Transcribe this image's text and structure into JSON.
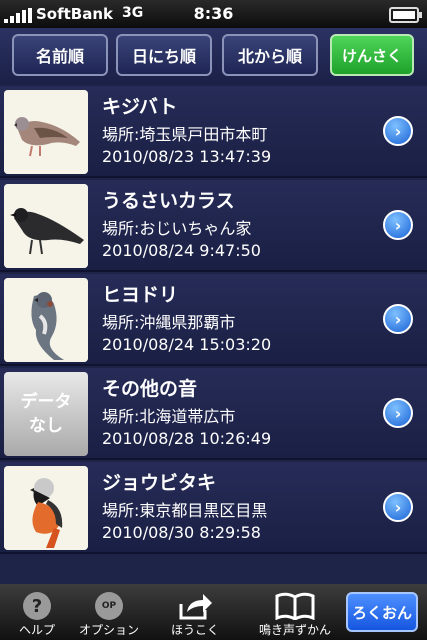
{
  "status": {
    "carrier": "SoftBank",
    "network": "3G",
    "time": "8:36"
  },
  "sort": {
    "by_name": "名前順",
    "by_date": "日にち順",
    "from_north": "北から順",
    "search": "けんさく"
  },
  "records": [
    {
      "name": "キジバト",
      "place": "場所:埼玉県戸田市本町",
      "date": "2010/08/23 13:47:39",
      "image": "bird-turtle-dove"
    },
    {
      "name": "うるさいカラス",
      "place": "場所:おじいちゃん家",
      "date": "2010/08/24 9:47:50",
      "image": "bird-crow"
    },
    {
      "name": "ヒヨドリ",
      "place": "場所:沖縄県那覇市",
      "date": "2010/08/24 15:03:20",
      "image": "bird-bulbul"
    },
    {
      "name": "その他の音",
      "place": "場所:北海道帯広市",
      "date": "2010/08/28 10:26:49",
      "image": "no-data",
      "no_data_label": "データなし"
    },
    {
      "name": "ジョウビタキ",
      "place": "場所:東京都目黒区目黒",
      "date": "2010/08/30 8:29:58",
      "image": "bird-redstart"
    }
  ],
  "tabbar": {
    "help": "ヘルプ",
    "help_icon_text": "?",
    "options": "オプション",
    "options_icon_text": "OP",
    "report": "ほうこく",
    "field_guide": "鳴き声ずかん",
    "record": "ろくおん"
  },
  "colors": {
    "background": "#1e2348",
    "search_green": "#1ea22a",
    "record_blue": "#1556e0"
  }
}
